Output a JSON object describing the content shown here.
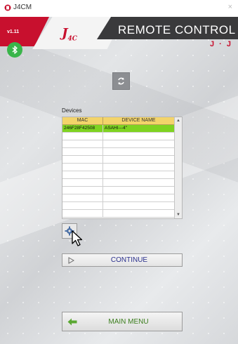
{
  "window": {
    "title": "J4CM",
    "close": "×"
  },
  "header": {
    "version": "v1.11",
    "logo_main": "J",
    "logo_sub": "4C",
    "title": "REMOTE CONTROL",
    "brand": "J · J"
  },
  "devices": {
    "label": "Devices",
    "columns": [
      "MAC",
      "DEVICE NAME"
    ],
    "rows": [
      {
        "mac": "246F28F42508",
        "name": "ASAHI---4\""
      }
    ],
    "empty_rows": 11
  },
  "buttons": {
    "continue": "CONTINUE",
    "main_menu": "MAIN MENU"
  },
  "icons": {
    "app": "app-logo-icon",
    "bluetooth": "bluetooth-icon",
    "refresh": "refresh-icon",
    "settings": "gear-icon",
    "continue": "play-outline-icon",
    "main_menu": "back-arrow-icon",
    "cursor": "mouse-pointer-icon"
  },
  "colors": {
    "accent_red": "#c8102e",
    "header_dark": "#3a3a3c",
    "selected_row": "#7fd321",
    "table_header": "#f3d46a",
    "bluetooth": "#39b54a"
  }
}
